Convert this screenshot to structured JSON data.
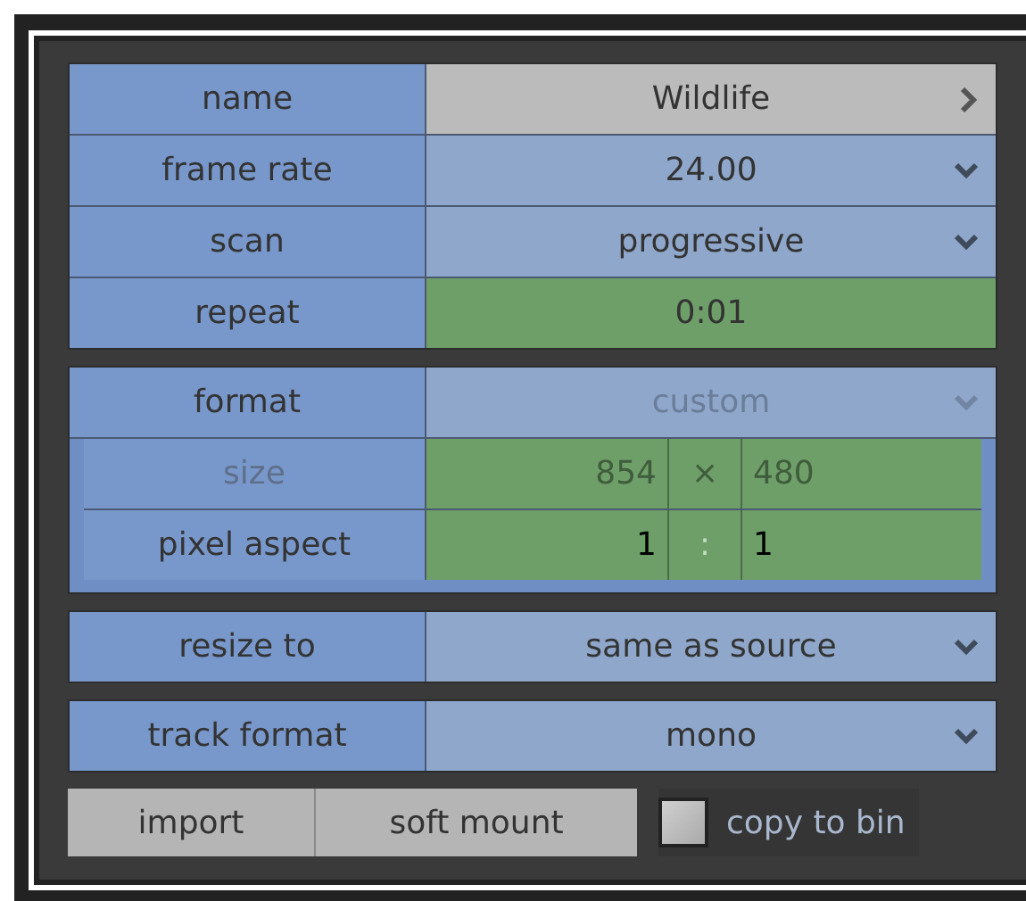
{
  "sections": [
    {
      "rows": [
        {
          "label": "name",
          "kind": "link",
          "value": "Wildlife",
          "disabled": false
        },
        {
          "label": "frame rate",
          "kind": "dropdown",
          "value": "24.00",
          "disabled": false
        },
        {
          "label": "scan",
          "kind": "dropdown",
          "value": "progressive",
          "disabled": false
        },
        {
          "label": "repeat",
          "kind": "field",
          "value": "0:01",
          "disabled": false
        }
      ]
    },
    {
      "rows": [
        {
          "label": "format",
          "kind": "dropdown",
          "value": "custom",
          "disabled": true,
          "children": [
            {
              "label": "size",
              "kind": "pair",
              "first": "854",
              "separator": "×",
              "second": "480",
              "disabled": true
            },
            {
              "label": "pixel aspect",
              "kind": "pair",
              "first": "1",
              "separator": ":",
              "second": "1",
              "disabled": false
            }
          ]
        }
      ]
    },
    {
      "rows": [
        {
          "label": "resize to",
          "kind": "dropdown",
          "value": "same as source",
          "disabled": false
        }
      ]
    },
    {
      "rows": [
        {
          "label": "track format",
          "kind": "dropdown",
          "value": "mono",
          "disabled": false
        }
      ]
    }
  ],
  "buttons": [
    "import",
    "soft mount"
  ],
  "copy_to_bin": {
    "label": "copy to bin",
    "checked": false
  }
}
